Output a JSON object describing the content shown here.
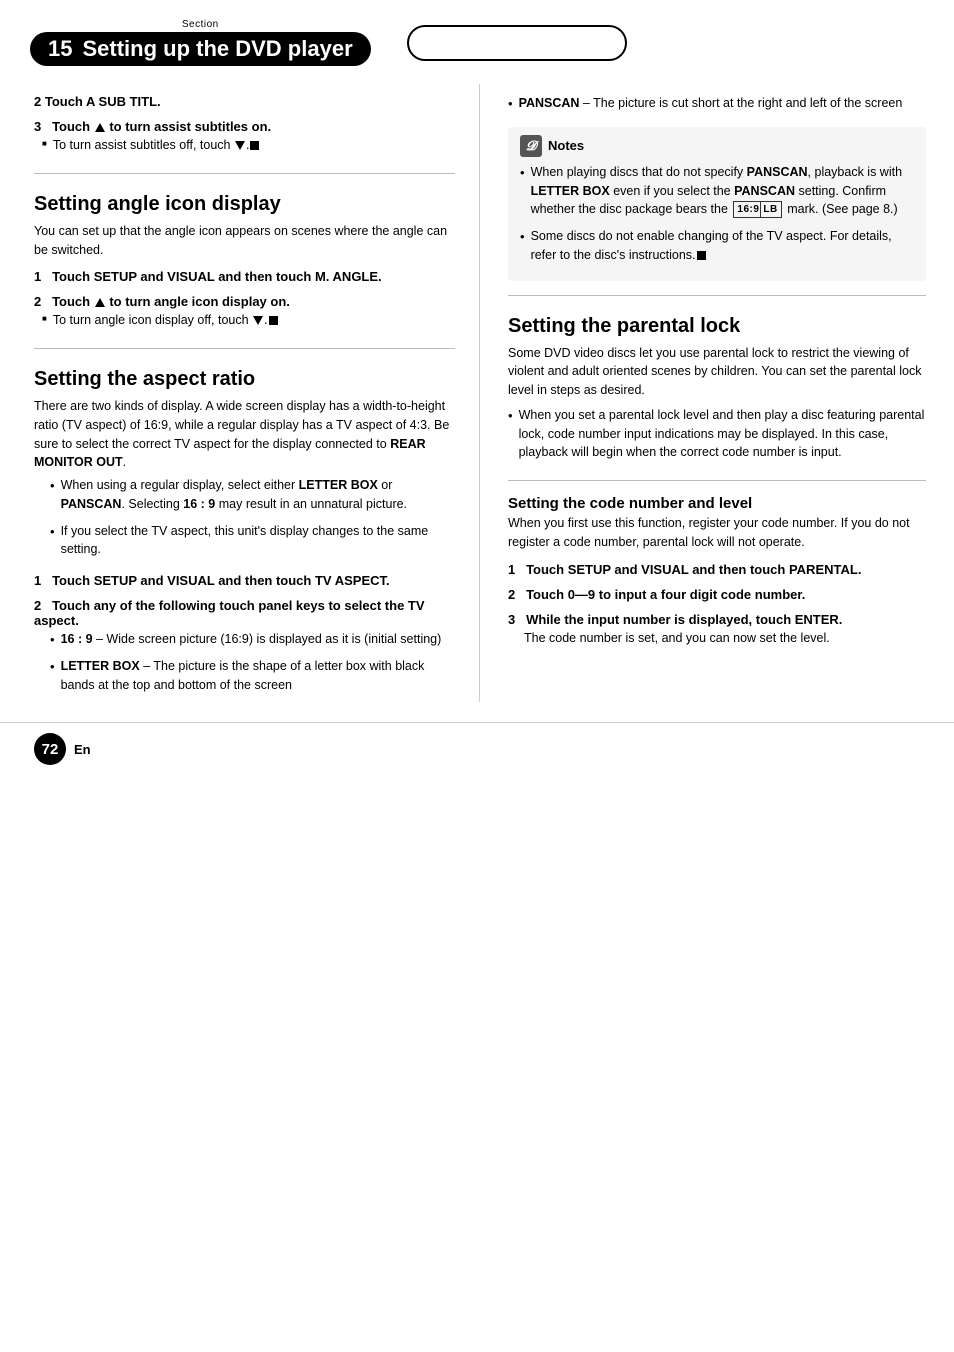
{
  "header": {
    "section_label": "Section",
    "section_number": "15",
    "section_title": "Setting up the DVD player"
  },
  "footer": {
    "page_number": "72",
    "lang": "En"
  },
  "left_column": {
    "step2_heading": "2   Touch A SUB TITL.",
    "step3_heading": "3   Touch ▲ to turn assist subtitles on.",
    "step3_bullet": "To turn assist subtitles off, touch ▼.",
    "section1_title": "Setting angle icon display",
    "section1_body": "You can set up that the angle icon appears on scenes where the angle can be switched.",
    "step1a_heading": "1   Touch SETUP and VISUAL and then touch M. ANGLE.",
    "step2a_heading": "2   Touch ▲ to turn angle icon display on.",
    "step2a_bullet": "To turn angle icon display off, touch ▼.",
    "section2_title": "Setting the aspect ratio",
    "section2_body": "There are two kinds of display. A wide screen display has a width-to-height ratio (TV aspect) of 16:9, while a regular display has a TV aspect of 4:3. Be sure to select the correct TV aspect for the display connected to REAR MONITOR OUT.",
    "bullet1": "When using a regular display, select either LETTER BOX or PANSCAN. Selecting 16 : 9 may result in an unnatural picture.",
    "bullet2": "If you select the TV aspect, this unit's display changes to the same setting.",
    "step1b_heading": "1   Touch SETUP and VISUAL and then touch TV ASPECT.",
    "step2b_heading": "2   Touch any of the following touch panel keys to select the TV aspect.",
    "subbullet1_label": "16 : 9",
    "subbullet1_text": "– Wide screen picture (16:9) is displayed as it is (initial setting)",
    "subbullet2_label": "LETTER BOX",
    "subbullet2_text": "– The picture is the shape of a letter box with black bands at the top and bottom of the screen"
  },
  "right_column": {
    "subbullet3_label": "PANSCAN",
    "subbullet3_text": "– The picture is cut short at the right and left of the screen",
    "notes_title": "Notes",
    "note1_text": "When playing discs that do not specify PANSCAN, playback is with LETTER BOX even if you select the PANSCAN setting. Confirm whether the disc package bears the",
    "note1_mark": "16:9 LB",
    "note1_mark2": "mark. (See page 8.)",
    "note2_text": "Some discs do not enable changing of the TV aspect. For details, refer to the disc's instructions.",
    "section3_title": "Setting the parental lock",
    "section3_body": "Some DVD video discs let you use parental lock to restrict the viewing of violent and adult oriented scenes by children. You can set the parental lock level in steps as desired.",
    "parental_bullet": "When you set a parental lock level and then play a disc featuring parental lock, code number input indications may be displayed. In this case, playback will begin when the correct code number is input.",
    "section3b_title": "Setting the code number and level",
    "section3b_body": "When you first use this function, register your code number. If you do not register a code number, parental lock will not operate.",
    "step1c_heading": "1   Touch SETUP and VISUAL and then touch PARENTAL.",
    "step2c_heading": "2   Touch 0—9 to input a four digit code number.",
    "step3c_heading": "3   While the input number is displayed, touch ENTER.",
    "step3c_body": "The code number is set, and you can now set the level."
  }
}
